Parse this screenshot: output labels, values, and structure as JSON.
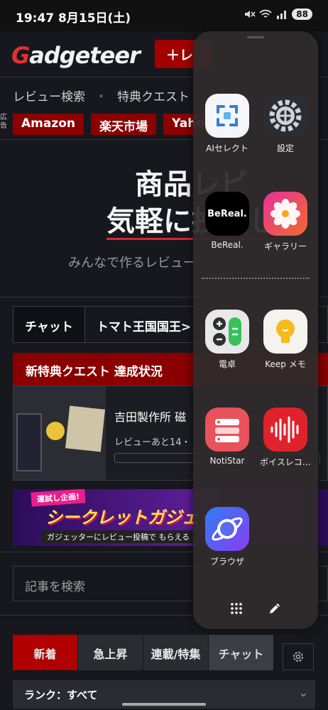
{
  "status_bar": {
    "time": "19:47",
    "date": "8月15日(土)",
    "battery": "88",
    "icons": [
      "mute-icon",
      "wifi-icon",
      "signal-icon"
    ]
  },
  "site": {
    "logo": "Gadgeteer",
    "logo_initial": "G",
    "logo_rest": "adgeteer",
    "review_button": "＋レ",
    "nav": [
      "レビュー検索",
      "特典クエスト"
    ],
    "nav_sep": "・",
    "ad_label": "広告",
    "ads": [
      "Amazon",
      "楽天市場",
      "Yaho"
    ],
    "hero_line1": "商品レビ",
    "hero_line2": "気軽に投稿し",
    "hero_sub": "みんなで作るレビュー",
    "tabs": [
      "チャット",
      "トマト王国国王>"
    ],
    "quest_head": "新特典クエスト 達成状況",
    "quest_title": "吉田製作所 磁",
    "quest_sub": "レビューあと14・",
    "banner_tag": "運試し企画!",
    "banner_main": "シークレットガジェット",
    "banner_sub": "ガジェッターにレビュー投稿で もらえる",
    "search_placeholder": "記事を検索",
    "feed_tabs": [
      "新着",
      "急上昇",
      "連載/特集",
      "チャット"
    ],
    "rank": "ランク：すべて",
    "rank_chevron": "⌄",
    "colors": {
      "accent": "#b00000",
      "logo_red": "#e03131"
    }
  },
  "edge_panel": {
    "apps": [
      {
        "label": "AIセレクト",
        "icon": "ai-select-icon",
        "color": "#f4f6fa"
      },
      {
        "label": "設定",
        "icon": "settings-gear-icon",
        "color": "#2b2d33"
      },
      {
        "label": "BeReal.",
        "icon": "bereal-icon",
        "color": "#000000",
        "icon_text": "BeReal."
      },
      {
        "label": "ギャラリー",
        "icon": "gallery-flower-icon",
        "color": "#e2247a"
      },
      {
        "label": "電卓",
        "icon": "calculator-icon",
        "color": "#e8e8e8"
      },
      {
        "label": "Keep メモ",
        "icon": "keep-bulb-icon",
        "color": "#f5f3ee"
      },
      {
        "label": "NotiStar",
        "icon": "notistar-icon",
        "color": "#e8525b"
      },
      {
        "label": "ボイスレコ…",
        "icon": "voice-recorder-icon",
        "color": "#e0222c"
      },
      {
        "label": "ブラウザ",
        "icon": "browser-planet-icon",
        "color": "#4a5cf0"
      }
    ],
    "footer": [
      "grid-menu-icon",
      "edit-pencil-icon"
    ]
  }
}
